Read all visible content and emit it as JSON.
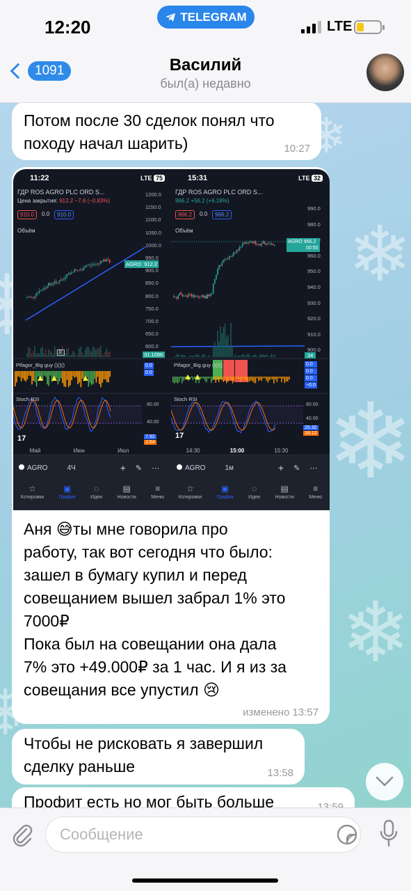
{
  "status_bar": {
    "time": "12:20",
    "pill": "TELEGRAM",
    "network": "LTE"
  },
  "header": {
    "back_count": "1091",
    "name": "Василий",
    "status": "был(а) недавно"
  },
  "messages": [
    {
      "text": "Потом после 30 сделок понял что\nпоходу начал шарить)",
      "time": "10:27"
    },
    {
      "text": "Аня 😅ты мне говорила про\nработу, так вот сегодня что было:\nзашел в бумагу купил и перед\nсовещанием вышел забрал 1% это\n7000₽\nПока был на совещании она дала\n7% это +49.000₽ за 1 час. И я из за\nсовещания все упустил 😢",
      "time": "изменено 13:57"
    },
    {
      "text": "Чтобы не рисковать я завершил\nсделку раньше",
      "time": "13:58"
    },
    {
      "text": "Профит есть но мог быть больше",
      "time": "13:59"
    }
  ],
  "screenshots": [
    {
      "time": "11:22",
      "network": "LTE",
      "battery": "75",
      "ticker": "ГДР ROS AGRO PLC ORD S...",
      "close_label": "Цена закрытия:",
      "close_value": "912.2",
      "change": "−7.6 (−0.83%)",
      "bid": "910.0",
      "spread": "0.0",
      "ask": "910.0",
      "volume_label": "Объём",
      "price_ticks": [
        "1200.0",
        "1150.0",
        "1100.0",
        "1050.0",
        "1000.0",
        "950.0",
        "900.0",
        "850.0",
        "800.0",
        "750.0",
        "700.0",
        "650.0",
        "600.0"
      ],
      "price_tag_symbol": "AGRO",
      "price_tag_value": "912.2",
      "volume_value": "31.109K",
      "marker_e": "E",
      "indicator1": "Pifagor_Big guy ()()()",
      "indicator1_values": [
        "0.0",
        "0.0"
      ],
      "indicator2": "Stoch RSI",
      "stoch_ticks": [
        "80.00",
        "40.00"
      ],
      "stoch_values": [
        "7.92",
        "2.64"
      ],
      "x_labels": [
        "Май",
        "Июн",
        "Июл"
      ],
      "symbol": "AGRO",
      "interval": "4Ч",
      "tabs": [
        "Котировки",
        "График",
        "Идеи",
        "Новости",
        "Меню"
      ]
    },
    {
      "time": "15:31",
      "network": "LTE",
      "battery": "32",
      "ticker": "ГДР ROS AGRO PLC ORD S...",
      "close_value": "966.2",
      "change": "+56.2 (+6.18%)",
      "bid": "966.2",
      "spread": "0.0",
      "ask": "966.2",
      "volume_label": "Объём",
      "price_ticks": [
        "990.0",
        "980.0",
        "970.0",
        "960.0",
        "950.0",
        "940.0",
        "930.0",
        "920.0",
        "910.0",
        "900.0"
      ],
      "price_tag_symbol": "AGRO",
      "price_tag_value": "966.2",
      "price_tag_timer": "00:50",
      "volume_value": "34",
      "indicator1": "Pifagor_Big guy ()()()",
      "indicator1_values": [
        "0.0",
        "0.0",
        "0.0",
        "−0.0"
      ],
      "indicator2": "Stoch RSI",
      "stoch_ticks": [
        "80.00",
        "40.00"
      ],
      "stoch_values": [
        "25.32",
        "18.12"
      ],
      "x_labels": [
        "14:30",
        "15:00",
        "15:30"
      ],
      "symbol": "AGRO",
      "interval": "1м",
      "tabs": [
        "Котировки",
        "График",
        "Идеи",
        "Новости",
        "Меню"
      ]
    }
  ],
  "input": {
    "placeholder": "Сообщение"
  },
  "colors": {
    "accent": "#2f8ae8",
    "bubble": "#ffffff",
    "tv_bg": "#131722",
    "tv_up": "#26a69a",
    "tv_down": "#ef5350",
    "tv_blue": "#2962ff"
  },
  "icons": {
    "attach": "paperclip-icon",
    "sticker": "sticker-icon",
    "mic": "microphone-icon",
    "scroll": "chevron-down-icon",
    "back": "chevron-left-icon"
  }
}
